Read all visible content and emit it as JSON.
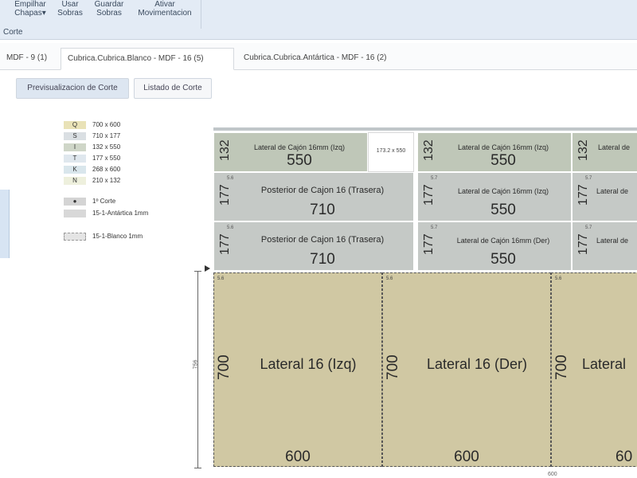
{
  "ribbon": {
    "buttons": [
      {
        "label": "Empilhar Chapas▾"
      },
      {
        "label": "Usar Sobras"
      },
      {
        "label": "Guardar Sobras"
      },
      {
        "label": "Ativar Movimentacion"
      }
    ],
    "group_label": "Corte"
  },
  "tabs": [
    {
      "label": "MDF - 9 (1)"
    },
    {
      "label": "Cubrica.Cubrica.Blanco - MDF - 16 (5)"
    },
    {
      "label": "Cubrica.Cubrica.Antártica - MDF - 16 (2)"
    }
  ],
  "subbuttons": {
    "preview": "Previsualizacion de Corte",
    "list": "Listado de Corte"
  },
  "legend": {
    "items": [
      {
        "code": "Q",
        "dims": "700 x 600",
        "color": "#e9e2b7"
      },
      {
        "code": "S",
        "dims": "710 x 177",
        "color": "#dadfe3"
      },
      {
        "code": "I",
        "dims": "132 x 550",
        "color": "#cfd6c8"
      },
      {
        "code": "T",
        "dims": "177 x 550",
        "color": "#dfe7ee"
      },
      {
        "code": "K",
        "dims": "268 x 600",
        "color": "#d9e6ec"
      },
      {
        "code": "N",
        "dims": "210 x 132",
        "color": "#eef0dd"
      }
    ],
    "cut": {
      "symbol": "●",
      "label": "1º Corte"
    },
    "edge1": {
      "label": "15-1-Antártica 1mm"
    },
    "edge2": {
      "label": "15-1-Blanco 1mm"
    }
  },
  "board": {
    "row1": [
      {
        "measure": "132",
        "title": "Lateral de Cajón 16mm (Izq)",
        "length": "550"
      },
      {
        "measure": "132",
        "title": "Lateral de Cajón 16mm (Izq)",
        "length": "550"
      },
      {
        "measure": "132",
        "title": "Lateral de"
      }
    ],
    "waste_label": "173.2 x 550",
    "row2": [
      {
        "measure": "177",
        "code": "5.6",
        "title": "Posterior de Cajon 16 (Trasera)",
        "length": "710"
      },
      {
        "measure": "177",
        "code": "5.7",
        "title": "Lateral de Cajón 16mm (Izq)",
        "length": "550"
      },
      {
        "measure": "177",
        "code": "5.7",
        "title": "Lateral de"
      }
    ],
    "row3": [
      {
        "measure": "177",
        "code": "5.6",
        "title": "Posterior de Cajon 16 (Trasera)",
        "length": "710"
      },
      {
        "measure": "177",
        "code": "5.7",
        "title": "Lateral de Cajón 16mm (Der)",
        "length": "550"
      },
      {
        "measure": "177",
        "code": "5.7",
        "title": "Lateral de"
      }
    ],
    "big": [
      {
        "height": "700",
        "code": "5.6",
        "title": "Lateral 16 (Izq)",
        "width": "600"
      },
      {
        "height": "700",
        "code": "5.6",
        "title": "Lateral 16 (Der)",
        "width": "600"
      },
      {
        "height": "700",
        "code": "5.6",
        "title": "Lateral",
        "width": "60"
      }
    ],
    "side_dim": "756",
    "bottom_dim": "600"
  }
}
